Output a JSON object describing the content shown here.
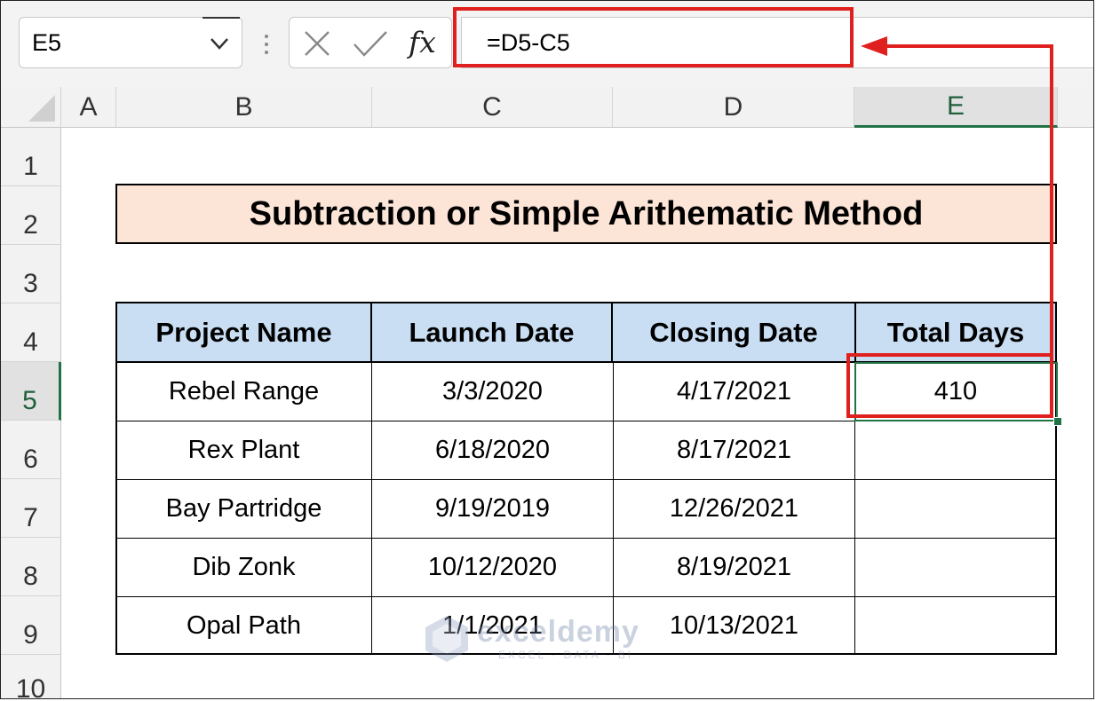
{
  "formula_bar": {
    "name_box": "E5",
    "fx_label": "fx",
    "formula": "=D5-C5"
  },
  "columns": [
    "A",
    "B",
    "C",
    "D",
    "E"
  ],
  "rows": [
    "1",
    "2",
    "3",
    "4",
    "5",
    "6",
    "7",
    "8",
    "9",
    "10"
  ],
  "selected_cell": "E5",
  "title": "Subtraction or Simple Arithematic Method",
  "table": {
    "headers": [
      "Project Name",
      "Launch Date",
      "Closing Date",
      "Total Days"
    ],
    "rows": [
      [
        "Rebel Range",
        "3/3/2020",
        "4/17/2021",
        "410"
      ],
      [
        "Rex Plant",
        "6/18/2020",
        "8/17/2021",
        ""
      ],
      [
        "Bay Partridge",
        "9/19/2019",
        "12/26/2021",
        ""
      ],
      [
        "Dib Zonk",
        "10/12/2020",
        "8/19/2021",
        ""
      ],
      [
        "Opal Path",
        "1/1/2021",
        "10/13/2021",
        ""
      ]
    ]
  },
  "watermark": {
    "brand": "exceldemy",
    "tagline": "EXCEL · DATA · BI"
  },
  "colors": {
    "highlight_red": "#e0201e",
    "excel_green": "#217346",
    "title_fill": "#fce4d6",
    "header_fill": "#c9def3"
  }
}
